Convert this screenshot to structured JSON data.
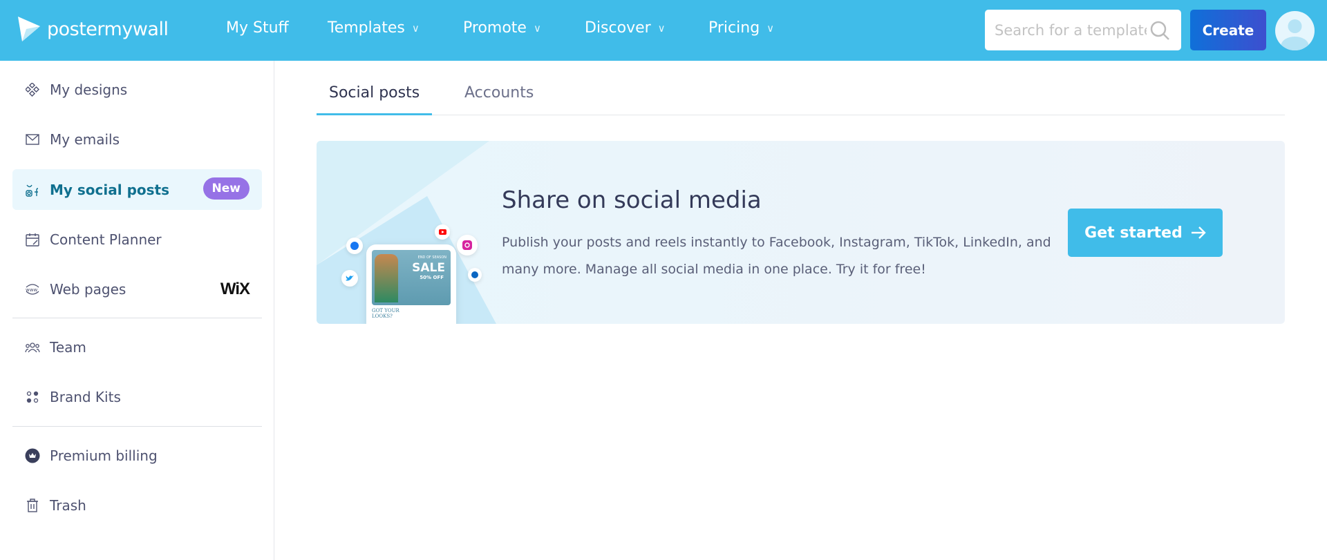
{
  "header": {
    "logo": "postermywall",
    "nav": [
      {
        "label": "My Stuff",
        "dropdown": false
      },
      {
        "label": "Templates",
        "dropdown": true
      },
      {
        "label": "Promote",
        "dropdown": true
      },
      {
        "label": "Discover",
        "dropdown": true
      },
      {
        "label": "Pricing",
        "dropdown": true
      }
    ],
    "search_placeholder": "Search for a template",
    "create_label": "Create"
  },
  "sidebar": {
    "items": [
      {
        "label": "My designs",
        "icon": "designs-icon"
      },
      {
        "label": "My emails",
        "icon": "envelope-icon"
      },
      {
        "label": "My social posts",
        "icon": "social-icon",
        "active": true,
        "badge": "New"
      },
      {
        "label": "Content Planner",
        "icon": "calendar-icon"
      },
      {
        "label": "Web pages",
        "icon": "www-icon",
        "partner": "WiX"
      },
      {
        "label": "Team",
        "icon": "team-icon"
      },
      {
        "label": "Brand Kits",
        "icon": "brand-kits-icon"
      },
      {
        "label": "Premium billing",
        "icon": "crown-icon"
      },
      {
        "label": "Trash",
        "icon": "trash-icon"
      }
    ]
  },
  "tabs": [
    {
      "label": "Social posts",
      "active": true
    },
    {
      "label": "Accounts"
    }
  ],
  "banner": {
    "title": "Share on social media",
    "description": "Publish your posts and reels instantly to Facebook, Instagram, TikTok, LinkedIn, and many more. Manage all social media in one place. Try it for free!",
    "button": "Get started",
    "mock": {
      "tag": "END OF SEASON",
      "headline": "SALE",
      "offer": "50% OFF",
      "tagline": "GOT YOUR LOOKS?"
    }
  },
  "colors": {
    "header": "#40bce9",
    "accent": "#40bce9",
    "create": "#2a5fd4",
    "badge": "#9672e6"
  }
}
